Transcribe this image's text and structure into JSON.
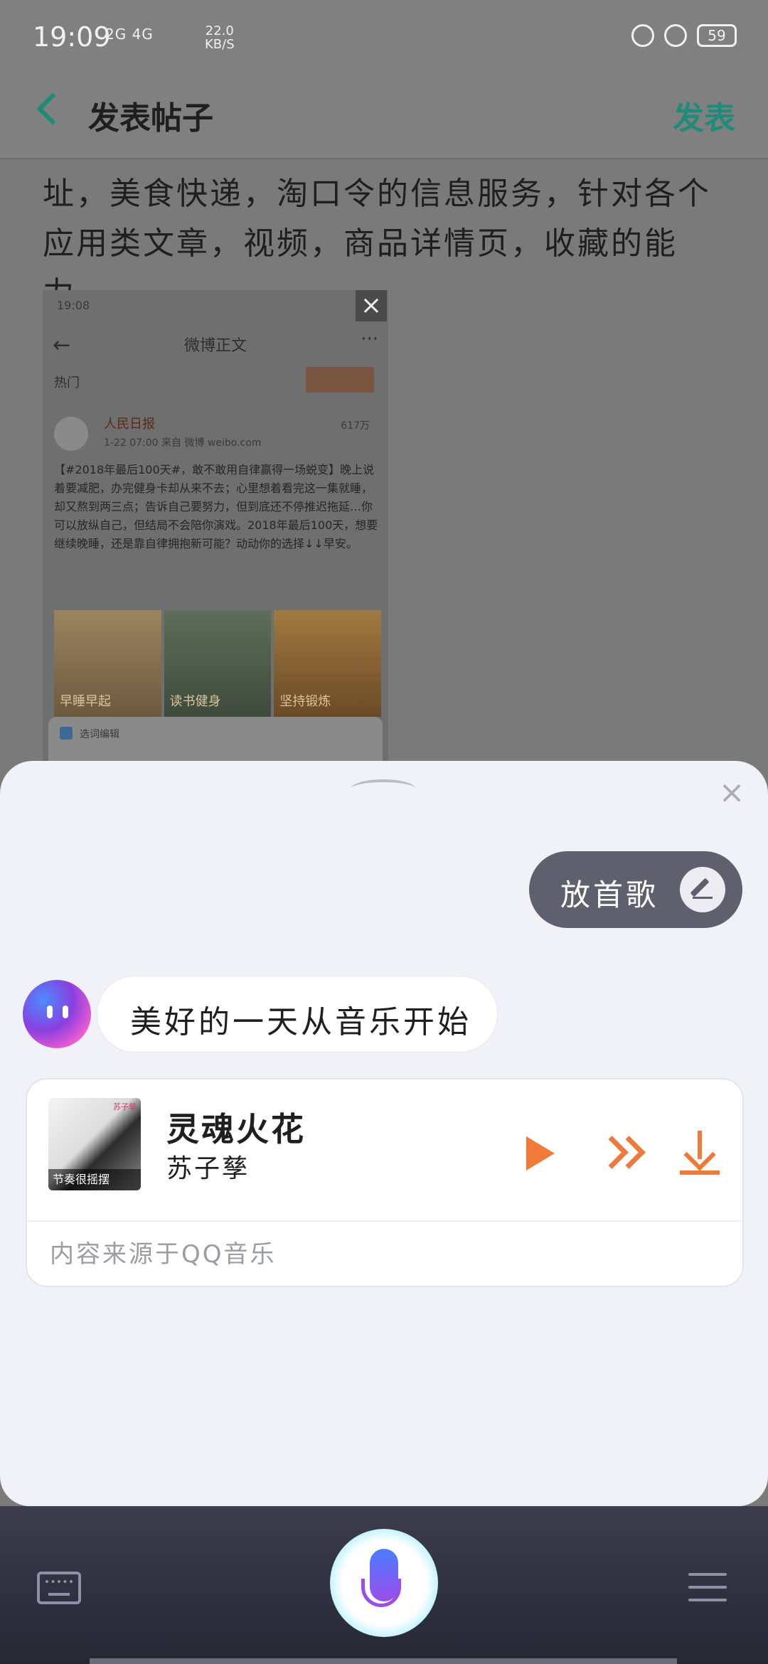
{
  "status_bar": {
    "time": "19:09",
    "network": "2G 4G",
    "speed_value": "22.0",
    "speed_unit": "KB/S",
    "battery": "59"
  },
  "app_bar": {
    "title": "发表帖子",
    "publish_label": "发表"
  },
  "post_body": "址，美食快递，淘口令的信息服务，针对各个应用类文章，视频，商品详情页，收藏的能力。",
  "embedded_screenshot": {
    "time": "19:08",
    "title": "微博正文",
    "tab": "热门",
    "account_name": "人民日报",
    "meta": "1-22 07:00  来自 微博 weibo.com",
    "count": "617万",
    "post_text": "【#2018年最后100天#，敢不敢用自律赢得一场蜕变】晚上说着要减肥，办完健身卡却从来不去；心里想着看完这一集就睡，却又熬到两三点；告诉自己要努力，但到底还不停推迟拖延…你可以放纵自己，但结局不会陪你演戏。2018年最后100天，想要继续晚睡，还是靠自律拥抱新可能？动动你的选择↓↓早安。",
    "images": [
      "早睡早起",
      "读书健身",
      "坚持锻炼"
    ],
    "edit_bar_label": "选词编辑",
    "accent_color": "#3b6a9a"
  },
  "assistant": {
    "user_query": "放首歌",
    "bot_reply": "美好的一天从音乐开始",
    "music_card": {
      "song_title": "灵魂火花",
      "artist": "苏子孳",
      "cover_label": "节奏很摇摆",
      "cover_top_text": "苏子孳",
      "source_text": "内容来源于QQ音乐",
      "control_color": "#f07a3a"
    }
  },
  "icons": {
    "back": "chevron-left-icon",
    "sheet_close": "close-icon",
    "edit": "pencil-icon",
    "play": "play-icon",
    "next": "fast-forward-icon",
    "download": "download-icon",
    "keyboard": "keyboard-icon",
    "mic": "microphone-icon",
    "menu": "hamburger-menu-icon"
  },
  "colors": {
    "accent_green": "#1e8c79",
    "bubble_dark": "#5e606e",
    "sheet_bg": "#f1f2f8",
    "dock_bg": "#2f303e"
  }
}
